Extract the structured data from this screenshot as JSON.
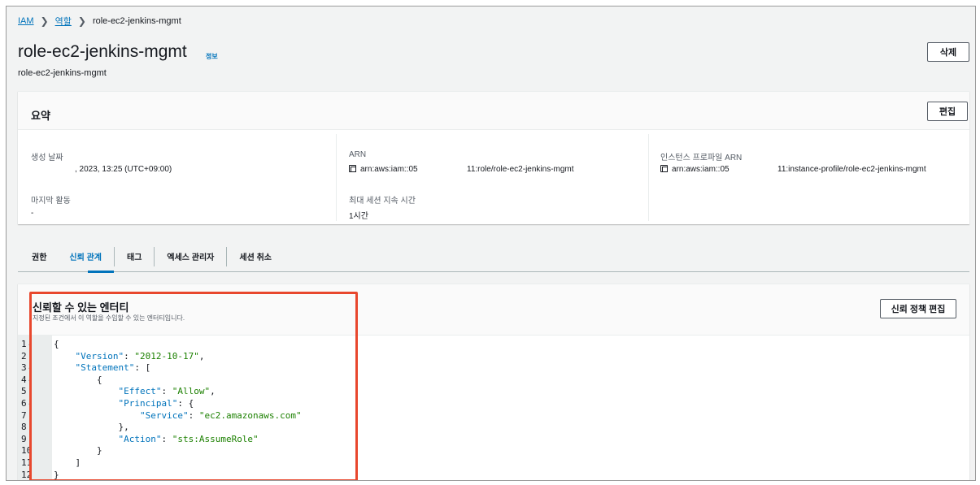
{
  "breadcrumb": {
    "iam": "IAM",
    "roles": "역할",
    "current": "role-ec2-jenkins-mgmt"
  },
  "page": {
    "title": "role-ec2-jenkins-mgmt",
    "info": "정보",
    "subtitle": "role-ec2-jenkins-mgmt",
    "delete_label": "삭제"
  },
  "summary": {
    "title": "요약",
    "edit_label": "편집",
    "created_label": "생성 날짜",
    "created_value": ", 2023, 13:25 (UTC+09:00)",
    "last_activity_label": "마지막 활동",
    "last_activity_value": "-",
    "arn_label": "ARN",
    "arn_prefix": "arn:aws:iam::05",
    "arn_suffix": "11:role/role-ec2-jenkins-mgmt",
    "max_session_label": "최대 세션 지속 시간",
    "max_session_value": "1시간",
    "instance_profile_label": "인스턴스 프로파일 ARN",
    "instance_profile_prefix": "arn:aws:iam::05",
    "instance_profile_suffix": "11:instance-profile/role-ec2-jenkins-mgmt"
  },
  "tabs": {
    "permissions": "권한",
    "trust": "신뢰 관계",
    "tags": "태그",
    "access_advisor": "엑세스 관리자",
    "revoke": "세션 취소"
  },
  "trust": {
    "title": "신뢰할 수 있는 엔터티",
    "description": "지정된 조건에서 이 역할을 수임할 수 있는 엔터티입니다.",
    "edit_policy_label": "신뢰 정책 편집"
  },
  "code_lines": [
    {
      "n": "1",
      "fold": true,
      "text": "{"
    },
    {
      "n": "2",
      "fold": false,
      "text": "    \"Version\": \"2012-10-17\","
    },
    {
      "n": "3",
      "fold": true,
      "text": "    \"Statement\": ["
    },
    {
      "n": "4",
      "fold": true,
      "text": "        {"
    },
    {
      "n": "5",
      "fold": false,
      "text": "            \"Effect\": \"Allow\","
    },
    {
      "n": "6",
      "fold": true,
      "text": "            \"Principal\": {"
    },
    {
      "n": "7",
      "fold": false,
      "text": "                \"Service\": \"ec2.amazonaws.com\""
    },
    {
      "n": "8",
      "fold": false,
      "text": "            },"
    },
    {
      "n": "9",
      "fold": false,
      "text": "            \"Action\": \"sts:AssumeRole\""
    },
    {
      "n": "10",
      "fold": false,
      "text": "        }"
    },
    {
      "n": "11",
      "fold": false,
      "text": "    ]"
    },
    {
      "n": "12",
      "fold": false,
      "text": "}"
    }
  ],
  "colors": {
    "link": "#0073bb",
    "highlight": "#e8472d",
    "string": "#1d8102"
  }
}
